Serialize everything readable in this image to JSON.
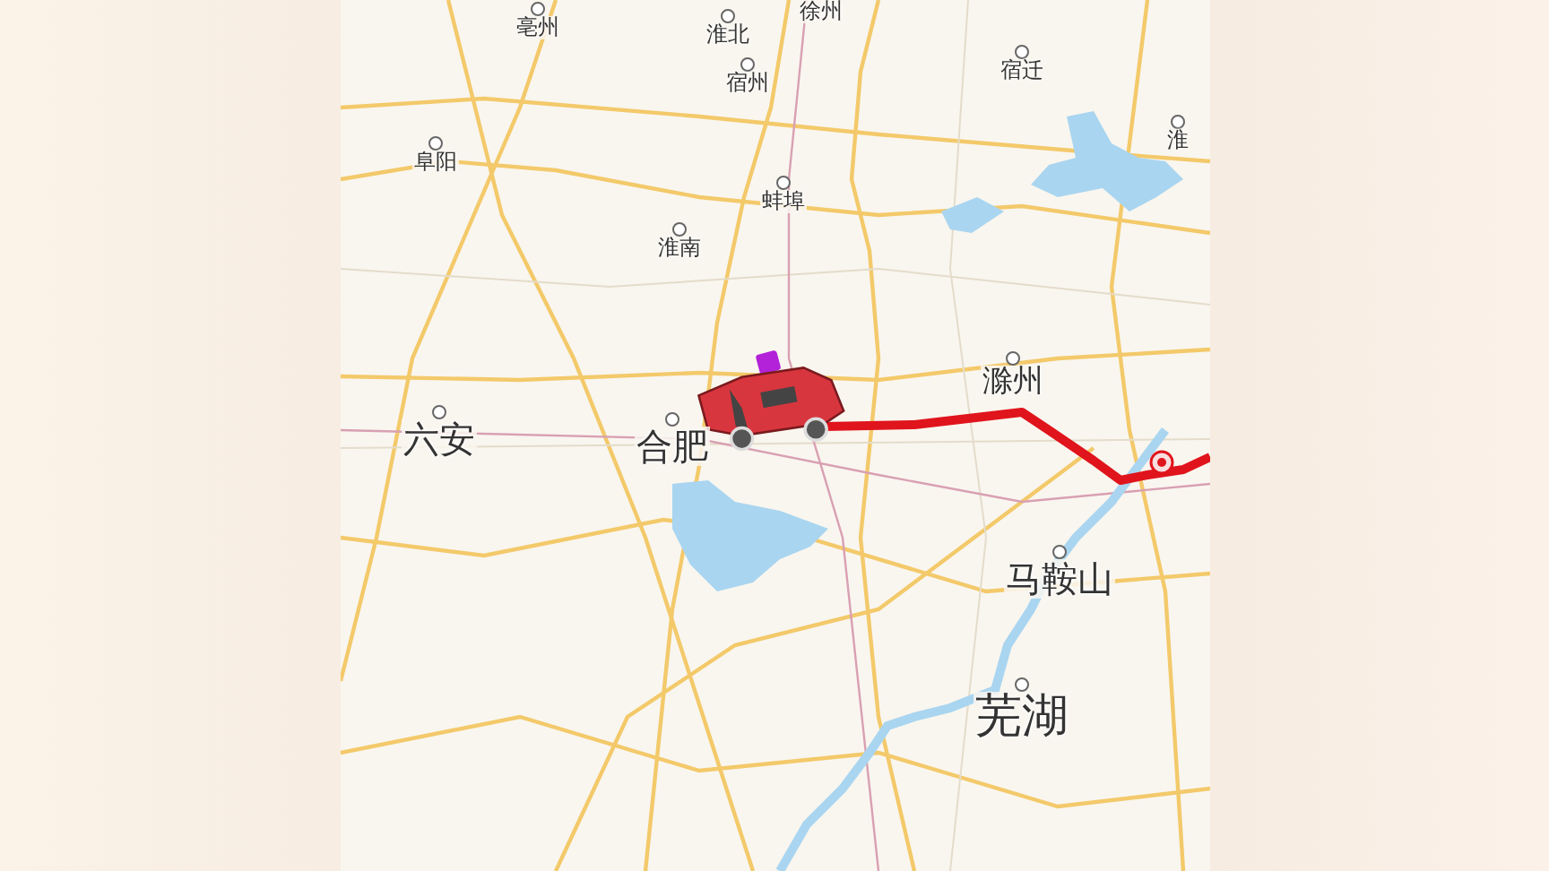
{
  "map": {
    "cities": [
      {
        "name": "亳州",
        "kind": "minor"
      },
      {
        "name": "淮北",
        "kind": "minor"
      },
      {
        "name": "徐州",
        "kind": "minor"
      },
      {
        "name": "宿州",
        "kind": "minor"
      },
      {
        "name": "宿迁",
        "kind": "minor"
      },
      {
        "name": "淮",
        "kind": "minor"
      },
      {
        "name": "阜阳",
        "kind": "minor"
      },
      {
        "name": "蚌埠",
        "kind": "minor"
      },
      {
        "name": "淮南",
        "kind": "minor"
      },
      {
        "name": "滁州",
        "kind": "medium"
      },
      {
        "name": "六安",
        "kind": "major"
      },
      {
        "name": "合肥",
        "kind": "major"
      },
      {
        "name": "马鞍山",
        "kind": "major"
      },
      {
        "name": "芜湖",
        "kind": "large"
      }
    ]
  }
}
